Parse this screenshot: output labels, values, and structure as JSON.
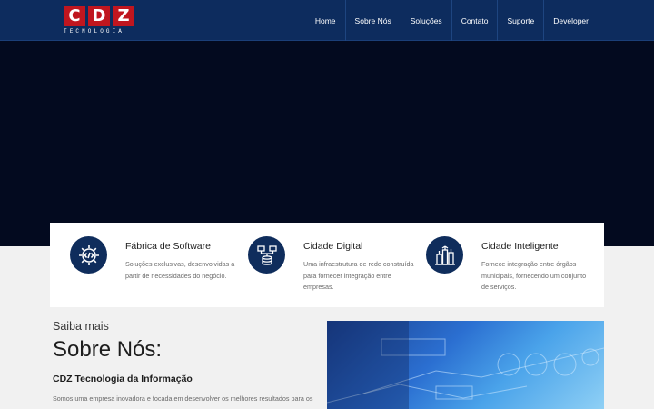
{
  "logo": {
    "letters": [
      "C",
      "D",
      "Z"
    ],
    "subtitle": "TECNOLOGIA"
  },
  "nav": {
    "items": [
      "Home",
      "Sobre Nós",
      "Soluções",
      "Contato",
      "Suporte",
      "Developer"
    ]
  },
  "features": [
    {
      "icon": "gear-code-icon",
      "title": "Fábrica de Software",
      "description": "Soluções exclusivas, desenvolvidas a partir de necessidades do negócio."
    },
    {
      "icon": "network-database-icon",
      "title": "Cidade Digital",
      "description": "Uma infraestrutura de rede construída para fornecer integração entre empresas."
    },
    {
      "icon": "smart-city-icon",
      "title": "Cidade Inteligente",
      "description": "Fornece integração entre órgãos municipais, fornecendo um conjunto de serviços."
    }
  ],
  "about": {
    "kicker": "Saiba mais",
    "title": "Sobre Nós:",
    "subtitle": "CDZ Tecnologia da Informação",
    "body": "Somos uma empresa inovadora e focada em desenvolver os melhores resultados para os"
  },
  "colors": {
    "header_bg": "#0d2c5e",
    "hero_bg": "#030a1f",
    "brand_red": "#c0161f",
    "icon_circle": "#0f2d5c"
  }
}
